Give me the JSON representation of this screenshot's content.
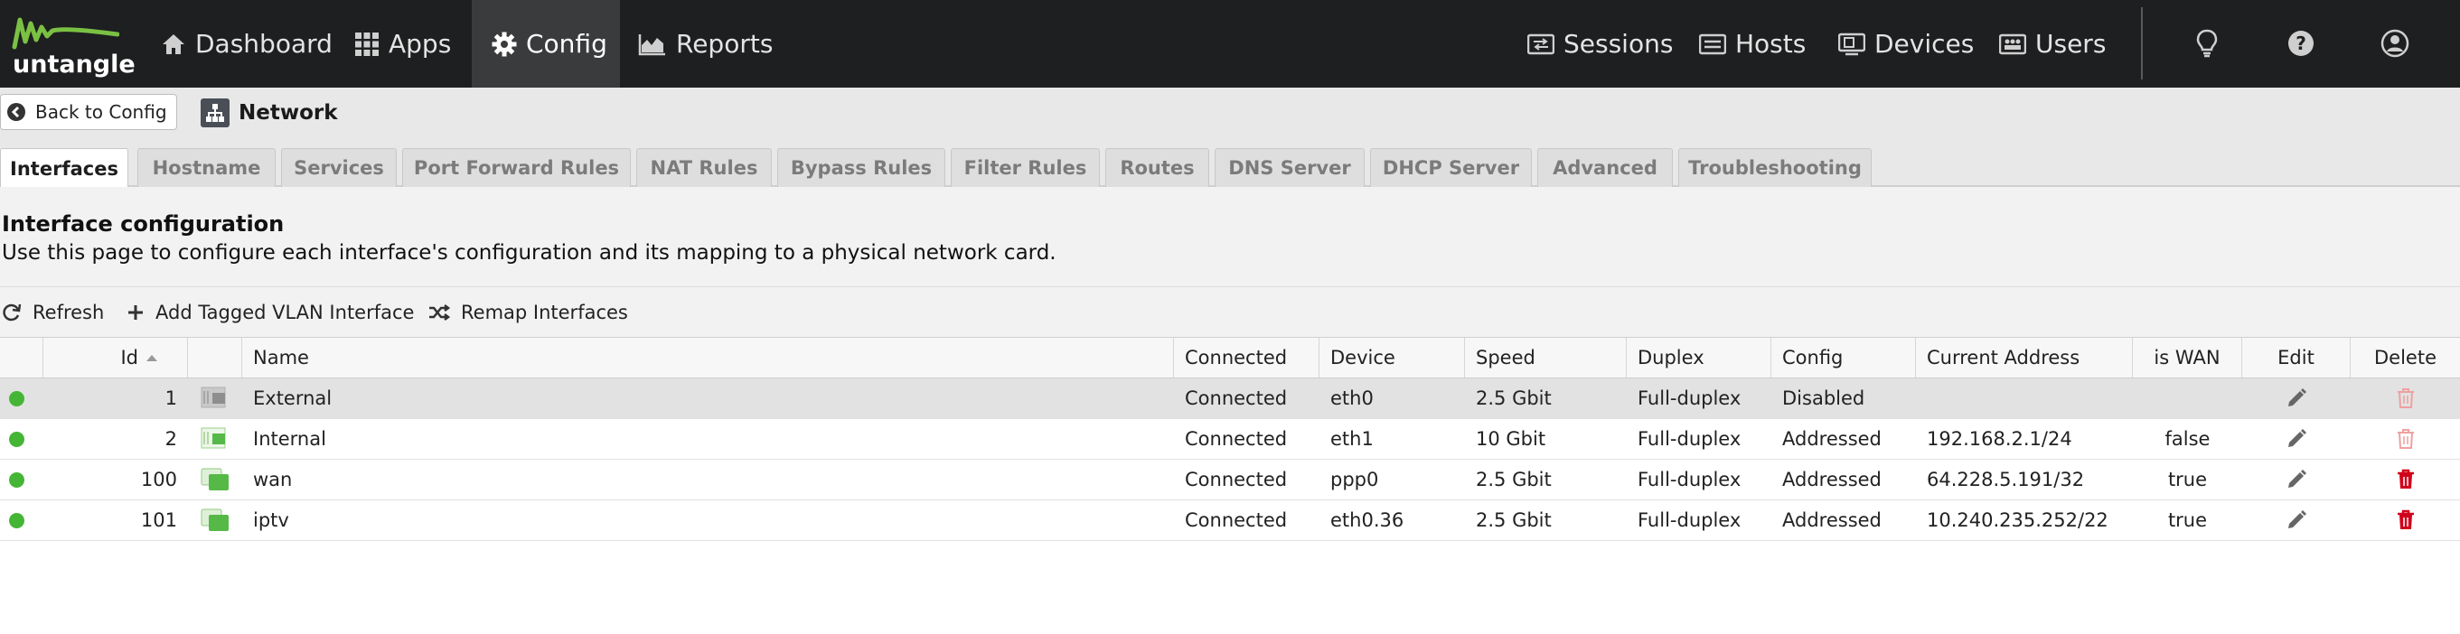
{
  "app": {
    "logo_text": "untangle",
    "nav": [
      {
        "label": "Dashboard",
        "icon": "home-icon"
      },
      {
        "label": "Apps",
        "icon": "apps-grid-icon"
      },
      {
        "label": "Config",
        "icon": "gear-icon",
        "active": true
      },
      {
        "label": "Reports",
        "icon": "area-chart-icon"
      }
    ],
    "right_nav": [
      {
        "label": "Sessions",
        "icon": "sessions-icon"
      },
      {
        "label": "Hosts",
        "icon": "hosts-icon"
      },
      {
        "label": "Devices",
        "icon": "devices-icon"
      },
      {
        "label": "Users",
        "icon": "users-icon"
      }
    ],
    "utility_icons": [
      "lightbulb-icon",
      "help-icon",
      "account-icon"
    ]
  },
  "config_bar": {
    "back_label": "Back to Config",
    "title": "Network"
  },
  "tabs": [
    {
      "label": "Interfaces",
      "active": true
    },
    {
      "label": "Hostname"
    },
    {
      "label": "Services"
    },
    {
      "label": "Port Forward Rules"
    },
    {
      "label": "NAT Rules"
    },
    {
      "label": "Bypass Rules"
    },
    {
      "label": "Filter Rules"
    },
    {
      "label": "Routes"
    },
    {
      "label": "DNS Server"
    },
    {
      "label": "DHCP Server"
    },
    {
      "label": "Advanced"
    },
    {
      "label": "Troubleshooting"
    }
  ],
  "panel": {
    "title": "Interface configuration",
    "description": "Use this page to configure each interface's configuration and its mapping to a physical network card."
  },
  "toolbar": {
    "refresh_label": "Refresh",
    "add_vlan_label": "Add Tagged VLAN Interface",
    "remap_label": "Remap Interfaces"
  },
  "grid": {
    "columns": {
      "id": "Id",
      "name": "Name",
      "connected": "Connected",
      "device": "Device",
      "speed": "Speed",
      "duplex": "Duplex",
      "config": "Config",
      "current_address": "Current Address",
      "is_wan": "is WAN",
      "edit": "Edit",
      "delete": "Delete"
    },
    "sort": {
      "column": "Id",
      "direction": "ascending"
    },
    "rows": [
      {
        "id": "1",
        "name": "External",
        "connected": "Connected",
        "device": "eth0",
        "speed": "2.5 Gbit",
        "duplex": "Full-duplex",
        "config": "Disabled",
        "current_address": "",
        "is_wan": "",
        "selected": true,
        "deletable": false,
        "type_icon": "disabled-interface-icon"
      },
      {
        "id": "2",
        "name": "Internal",
        "connected": "Connected",
        "device": "eth1",
        "speed": "10 Gbit",
        "duplex": "Full-duplex",
        "config": "Addressed",
        "current_address": "192.168.2.1/24",
        "is_wan": "false",
        "selected": false,
        "deletable": false,
        "type_icon": "physical-interface-icon"
      },
      {
        "id": "100",
        "name": "wan",
        "connected": "Connected",
        "device": "ppp0",
        "speed": "2.5 Gbit",
        "duplex": "Full-duplex",
        "config": "Addressed",
        "current_address": "64.228.5.191/32",
        "is_wan": "true",
        "selected": false,
        "deletable": true,
        "type_icon": "virtual-interface-icon"
      },
      {
        "id": "101",
        "name": "iptv",
        "connected": "Connected",
        "device": "eth0.36",
        "speed": "2.5 Gbit",
        "duplex": "Full-duplex",
        "config": "Addressed",
        "current_address": "10.240.235.252/22",
        "is_wan": "true",
        "selected": false,
        "deletable": true,
        "type_icon": "virtual-interface-icon"
      }
    ]
  },
  "colors": {
    "topbar": "#1e1f20",
    "status_green": "#45b536",
    "interface_green": "#56b947",
    "delete_red": "#d0021b",
    "delete_disabled": "#f0a0a0"
  }
}
